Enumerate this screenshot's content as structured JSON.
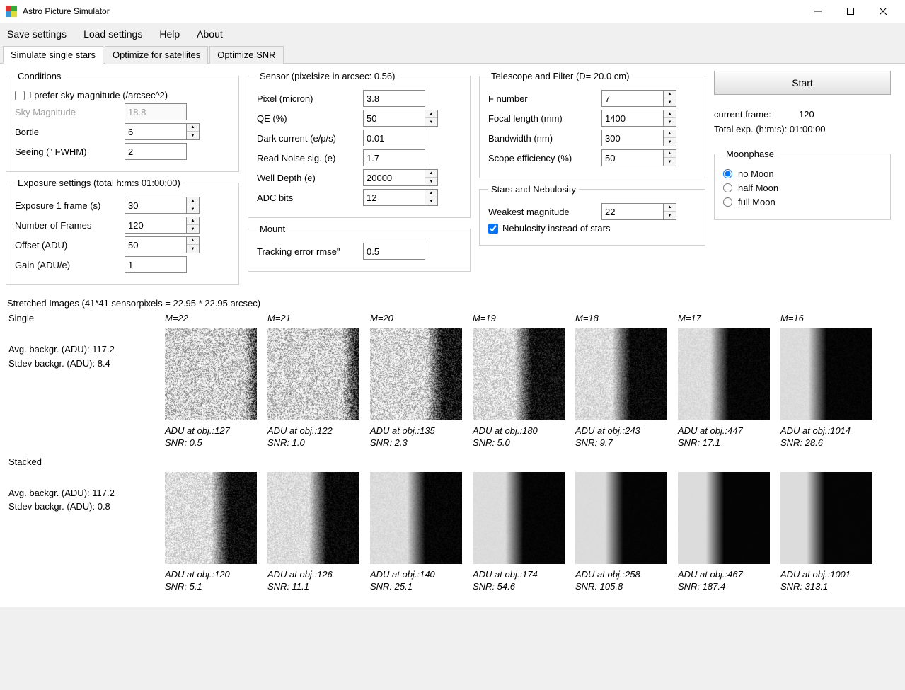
{
  "window": {
    "title": "Astro Picture Simulator"
  },
  "menu": {
    "save": "Save settings",
    "load": "Load settings",
    "help": "Help",
    "about": "About"
  },
  "tabs": {
    "t1": "Simulate single stars",
    "t2": "Optimize for satellites",
    "t3": "Optimize SNR"
  },
  "conditions": {
    "legend": "Conditions",
    "prefer_label": "I prefer sky magnitude (/arcsec^2)",
    "sky_mag_label": "Sky Magnitude",
    "sky_mag": "18.8",
    "bortle_label": "Bortle",
    "bortle": "6",
    "seeing_label": "Seeing (\" FWHM)",
    "seeing": "2"
  },
  "exposure": {
    "legend": "Exposure settings (total h:m:s 01:00:00)",
    "exp1_label": "Exposure 1 frame (s)",
    "exp1": "30",
    "nframes_label": "Number of Frames",
    "nframes": "120",
    "offset_label": "Offset (ADU)",
    "offset": "50",
    "gain_label": "Gain (ADU/e)",
    "gain": "1"
  },
  "sensor": {
    "legend": "Sensor  (pixelsize in arcsec: 0.56)",
    "pixel_label": "Pixel (micron)",
    "pixel": "3.8",
    "qe_label": "QE (%)",
    "qe": "50",
    "dark_label": "Dark current (e/p/s)",
    "dark": "0.01",
    "rn_label": "Read Noise sig. (e)",
    "rn": "1.7",
    "well_label": "Well Depth (e)",
    "well": "20000",
    "adc_label": "ADC bits",
    "adc": "12"
  },
  "mount": {
    "legend": "Mount",
    "track_label": "Tracking error rmse\"",
    "track": "0.5"
  },
  "telescope": {
    "legend": "Telescope and Filter (D= 20.0 cm)",
    "fnum_label": "F number",
    "fnum": "7",
    "fl_label": "Focal length (mm)",
    "fl": "1400",
    "bw_label": "Bandwidth (nm)",
    "bw": "300",
    "eff_label": "Scope efficiency (%)",
    "eff": "50"
  },
  "stars": {
    "legend": "Stars and Nebulosity",
    "weak_label": "Weakest magnitude",
    "weak": "22",
    "neb_label": "Nebulosity instead of stars"
  },
  "start": "Start",
  "status": {
    "cur_label": "current frame:",
    "cur": "120",
    "tot_label": "Total exp. (h:m:s): 01:00:00"
  },
  "moon": {
    "legend": "Moonphase",
    "no": "no Moon",
    "half": "half Moon",
    "full": "full Moon"
  },
  "stretched_header": "Stretched Images (41*41 sensorpixels = 22.95 * 22.95 arcsec)",
  "single_label": "Single",
  "stacked_label": "Stacked",
  "single_stats": {
    "avg": "Avg. backgr. (ADU): 117.2",
    "std": "Stdev backgr. (ADU): 8.4"
  },
  "stacked_stats": {
    "avg": "Avg. backgr. (ADU): 117.2",
    "std": "Stdev backgr. (ADU): 0.8"
  },
  "mags": {
    "m0": "M=22",
    "m1": "M=21",
    "m2": "M=20",
    "m3": "M=19",
    "m4": "M=18",
    "m5": "M=17",
    "m6": "M=16"
  },
  "single_caps": {
    "c0": {
      "a": "ADU at obj.:127",
      "b": "SNR: 0.5"
    },
    "c1": {
      "a": "ADU at obj.:122",
      "b": "SNR: 1.0"
    },
    "c2": {
      "a": "ADU at obj.:135",
      "b": "SNR: 2.3"
    },
    "c3": {
      "a": "ADU at obj.:180",
      "b": "SNR: 5.0"
    },
    "c4": {
      "a": "ADU at obj.:243",
      "b": "SNR: 9.7"
    },
    "c5": {
      "a": "ADU at obj.:447",
      "b": "SNR: 17.1"
    },
    "c6": {
      "a": "ADU at obj.:1014",
      "b": "SNR: 28.6"
    }
  },
  "stacked_caps": {
    "c0": {
      "a": "ADU at obj.:120",
      "b": "SNR: 5.1"
    },
    "c1": {
      "a": "ADU at obj.:126",
      "b": "SNR: 11.1"
    },
    "c2": {
      "a": "ADU at obj.:140",
      "b": "SNR: 25.1"
    },
    "c3": {
      "a": "ADU at obj.:174",
      "b": "SNR: 54.6"
    },
    "c4": {
      "a": "ADU at obj.:258",
      "b": "SNR: 105.8"
    },
    "c5": {
      "a": "ADU at obj.:467",
      "b": "SNR: 187.4"
    },
    "c6": {
      "a": "ADU at obj.:1001",
      "b": "SNR: 313.1"
    }
  }
}
